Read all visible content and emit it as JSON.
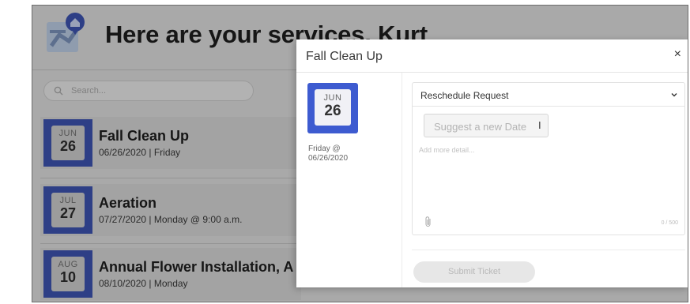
{
  "header": {
    "title": "Here are your services, Kurt"
  },
  "search": {
    "placeholder": "Search..."
  },
  "services": [
    {
      "month": "JUN",
      "day": "26",
      "name": "Fall Clean Up",
      "detail": "06/26/2020 | Friday"
    },
    {
      "month": "JUL",
      "day": "27",
      "name": "Aeration",
      "detail": "07/27/2020 | Monday @ 9:00 a.m."
    },
    {
      "month": "AUG",
      "day": "10",
      "name": "Annual Flower Installation, A",
      "detail": "08/10/2020 | Monday"
    }
  ],
  "modal": {
    "title": "Fall Clean Up",
    "close": "×",
    "month": "JUN",
    "day": "26",
    "when_line1": "Friday @",
    "when_line2": "06/26/2020",
    "request_type": "Reschedule Request",
    "date_placeholder": "Suggest a new Date",
    "cursor": "I",
    "detail_placeholder": "Add more detail...",
    "char_count": "0 / 500",
    "submit": "Submit Ticket"
  },
  "colors": {
    "accent": "#3d5bd0",
    "overlay": "#a9a9a9"
  },
  "icons": {
    "logo": "map-pin-home-icon",
    "search": "search-icon",
    "close": "close-icon",
    "chevron": "chevron-down-icon",
    "attach": "paperclip-icon"
  }
}
